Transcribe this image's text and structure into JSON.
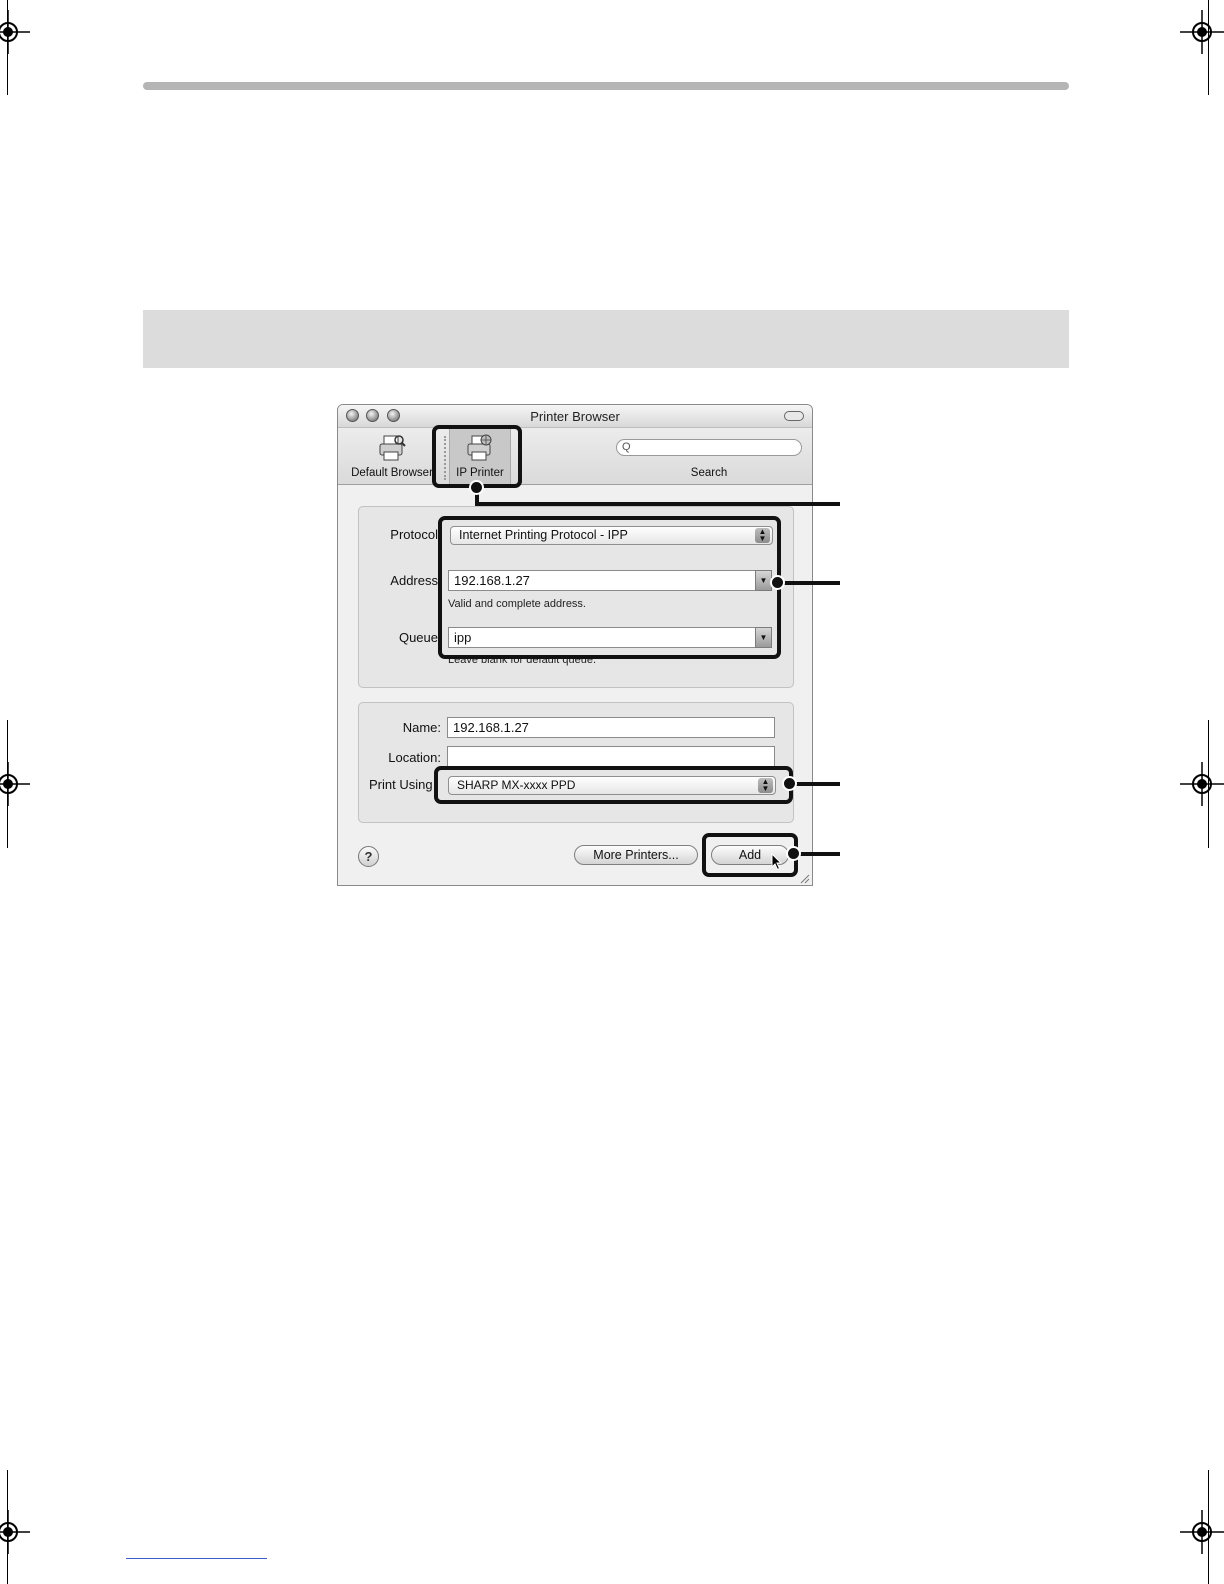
{
  "window": {
    "title": "Printer Browser",
    "toolbar": {
      "default_browser_label": "Default Browser",
      "ip_printer_label": "IP Printer",
      "search_label": "Search",
      "search_placeholder": "",
      "search_icon_glyph": "Q"
    },
    "connection": {
      "protocol_label": "Protocol",
      "protocol_value": "Internet Printing Protocol - IPP",
      "address_label": "Address",
      "address_value": "192.168.1.27",
      "address_hint": "Valid and complete address.",
      "queue_label": "Queue",
      "queue_value": "ipp",
      "queue_hint": "Leave blank for default queue."
    },
    "printer": {
      "name_label": "Name:",
      "name_value": "192.168.1.27",
      "location_label": "Location:",
      "location_value": "",
      "print_using_label": "Print Using",
      "print_using_value": "SHARP MX-xxxx PPD"
    },
    "footer": {
      "help_label": "?",
      "more_printers_label": "More Printers...",
      "add_label": "Add"
    }
  },
  "colors": {
    "page_rule": "#b5b5b5",
    "gray_band": "#dcdcdc",
    "callout": "#111111"
  }
}
